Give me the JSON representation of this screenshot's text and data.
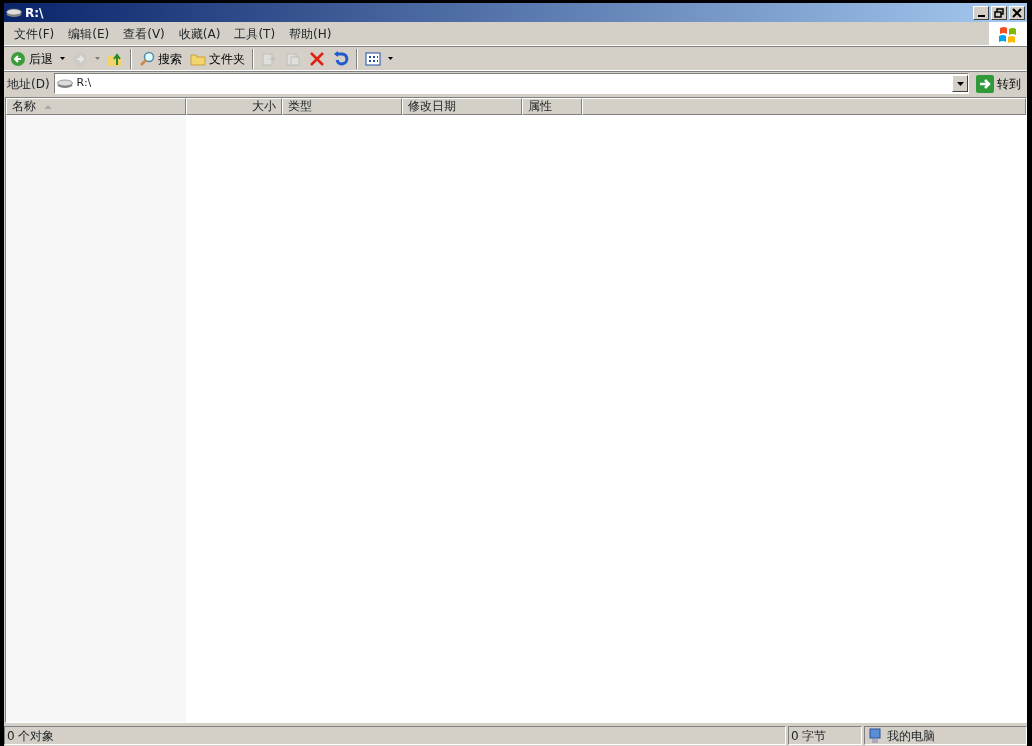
{
  "window": {
    "title": "R:\\"
  },
  "menu": [
    {
      "label": "文件(F)"
    },
    {
      "label": "编辑(E)"
    },
    {
      "label": "查看(V)"
    },
    {
      "label": "收藏(A)"
    },
    {
      "label": "工具(T)"
    },
    {
      "label": "帮助(H)"
    }
  ],
  "toolbar": [
    {
      "kind": "back",
      "label": "后退",
      "disabled": false
    },
    {
      "kind": "forward",
      "disabled": true
    },
    {
      "kind": "up",
      "disabled": false
    },
    {
      "kind": "sep"
    },
    {
      "kind": "search",
      "label": "搜索",
      "disabled": false
    },
    {
      "kind": "folders",
      "label": "文件夹",
      "disabled": false
    },
    {
      "kind": "sep"
    },
    {
      "kind": "move",
      "disabled": true
    },
    {
      "kind": "copy",
      "disabled": true
    },
    {
      "kind": "delete",
      "disabled": false
    },
    {
      "kind": "undo",
      "disabled": false
    },
    {
      "kind": "sep"
    },
    {
      "kind": "views",
      "disabled": false
    }
  ],
  "address": {
    "label": "地址(D)",
    "value": "R:\\",
    "go_label": "转到"
  },
  "columns": [
    {
      "label": "名称",
      "sorted": true
    },
    {
      "label": "大小",
      "sorted": false
    },
    {
      "label": "类型",
      "sorted": false
    },
    {
      "label": "修改日期",
      "sorted": false
    },
    {
      "label": "属性",
      "sorted": false
    }
  ],
  "status_bar": [
    {
      "text": "0 个对象",
      "kind": "text"
    },
    {
      "text": "0 字节",
      "kind": "text"
    },
    {
      "text": "我的电脑",
      "kind": "computer"
    }
  ]
}
